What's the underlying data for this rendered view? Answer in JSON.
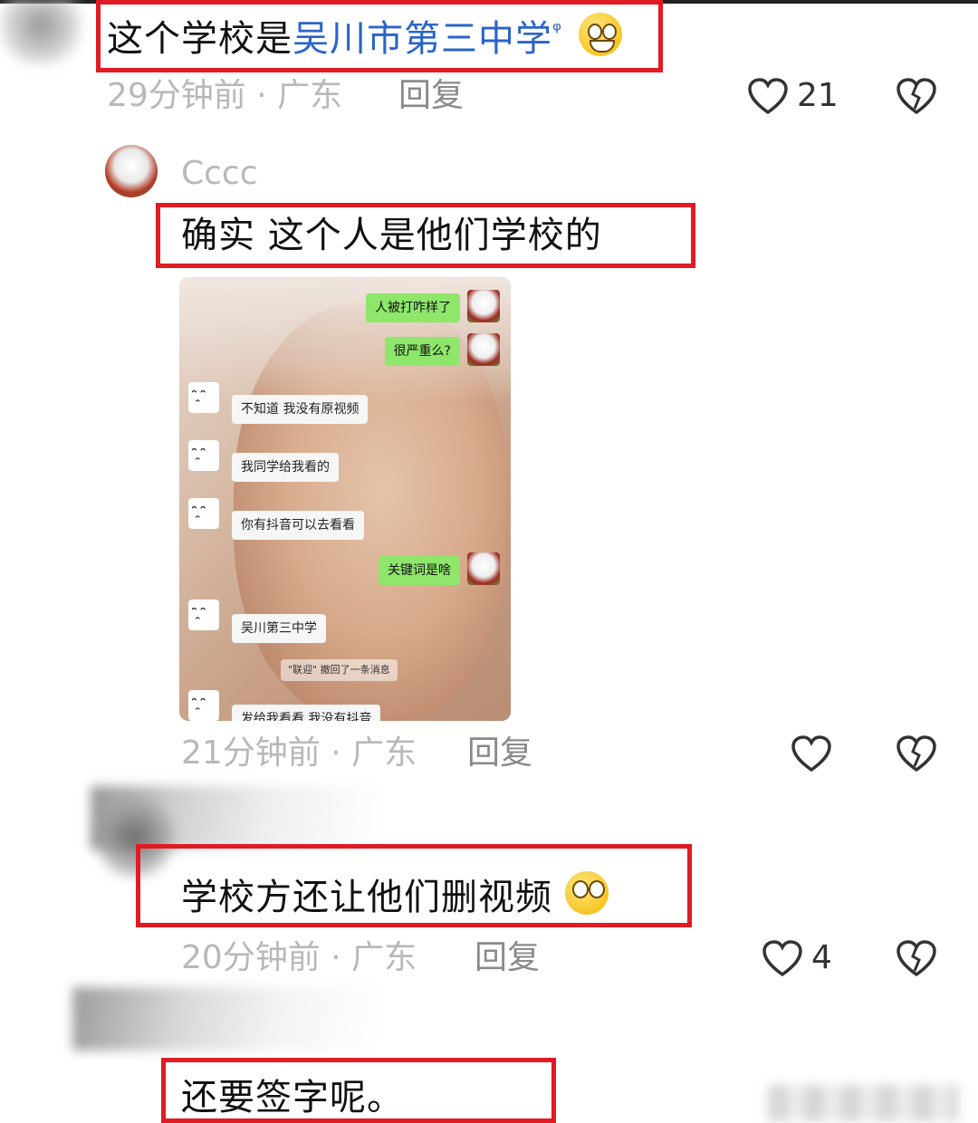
{
  "comment1": {
    "text_prefix": "这个学校是",
    "link_text": "吴川市第三中学",
    "search_mark": "ᵠ",
    "meta": "29分钟前 · 广东",
    "reply": "回复",
    "likes": "21"
  },
  "comment2": {
    "username": "Cccc",
    "text": "确实 这个人是他们学校的",
    "meta": "21分钟前 · 广东",
    "reply": "回复",
    "chat_image": {
      "messages": [
        {
          "side": "right",
          "text": "人被打咋样了"
        },
        {
          "side": "right",
          "text": "很严重么?"
        },
        {
          "side": "left",
          "text": "不知道 我没有原视频"
        },
        {
          "side": "left",
          "text": "我同学给我看的"
        },
        {
          "side": "left",
          "text": "你有抖音可以去看看"
        },
        {
          "side": "right",
          "text": "关键词是啥"
        },
        {
          "side": "left",
          "text": "吴川第三中学"
        },
        {
          "side": "system",
          "text": "\"联迎\" 撤回了一条消息"
        },
        {
          "side": "left",
          "text": "发给我看看 我没有抖音"
        }
      ]
    }
  },
  "comment3": {
    "text": "学校方还让他们删视频",
    "meta": "20分钟前 · 广东",
    "reply": "回复",
    "likes": "4"
  },
  "comment4": {
    "text": "还要签字呢。"
  },
  "colors": {
    "highlight_box": "#e01b24",
    "link": "#2a64c8",
    "chat_bubble_green": "#8ee66a"
  },
  "icons": [
    "heart-outline-icon",
    "heart-broken-icon",
    "search-icon"
  ]
}
